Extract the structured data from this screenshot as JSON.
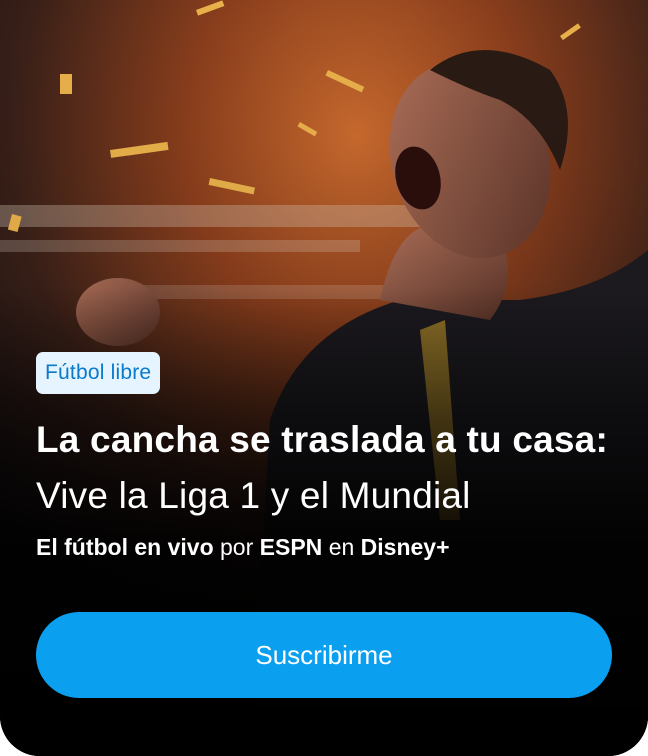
{
  "promo": {
    "badge": "Fútbol libre",
    "headline_bold": "La cancha se traslada a tu casa:",
    "headline_regular": "Vive la Liga 1 y el Mundial",
    "sub": {
      "part1": "El fútbol en vivo",
      "part2": "por",
      "part3": "ESPN",
      "part4": "en",
      "part5": "Disney+"
    },
    "cta_label": "Suscribirme"
  },
  "colors": {
    "badge_bg": "#e6f4ff",
    "badge_text": "#0a7acb",
    "cta_bg": "#0b9ff0",
    "text": "#ffffff",
    "card_bg": "#0b0b0d"
  }
}
